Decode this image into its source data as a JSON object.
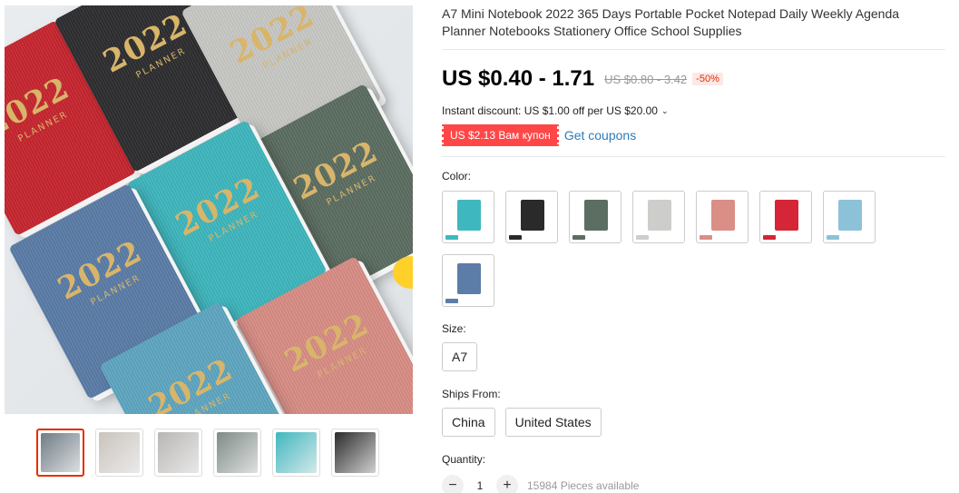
{
  "product": {
    "title": "A7 Mini Notebook 2022 365 Days Portable Pocket Notepad Daily Weekly Agenda Planner Notebooks Stationery Office School Supplies",
    "main_image": {
      "books": [
        {
          "color": "#c8262f",
          "text": "2022",
          "sub": "PLANNER"
        },
        {
          "color": "#2e2e30",
          "text": "2022",
          "sub": "PLANNER"
        },
        {
          "color": "#c9c9c6",
          "text": "2022",
          "sub": "PLANNER"
        },
        {
          "color": "#5c6e62",
          "text": "2022",
          "sub": "PLANNER"
        },
        {
          "color": "#3fb7bf",
          "text": "2022",
          "sub": "PLANNER"
        },
        {
          "color": "#5b7da8",
          "text": "2022",
          "sub": "PLANNER"
        },
        {
          "color": "#d98e86",
          "text": "2022",
          "sub": "PLANNER"
        },
        {
          "color": "#5fa7c2",
          "text": "2022",
          "sub": "PLANNER"
        }
      ]
    },
    "thumbnails": [
      {
        "color": "#6f7c85",
        "active": true
      },
      {
        "color": "#c9c3bd",
        "active": false
      },
      {
        "color": "#b8b6b4",
        "active": false
      },
      {
        "color": "#7e8a86",
        "active": false
      },
      {
        "color": "#3fb7bf",
        "active": false
      },
      {
        "color": "#2a2a2a",
        "active": false
      }
    ]
  },
  "pricing": {
    "price": "US $0.40 - 1.71",
    "old_price": "US $0.80 - 3.42",
    "discount": "-50%",
    "instant_discount": "Instant discount: US $1.00 off per US $20.00",
    "coupon": "US $2.13 Вам купон",
    "get_coupons": "Get coupons"
  },
  "options": {
    "color_label": "Color:",
    "colors": [
      {
        "name": "teal",
        "color": "#3fb7bf"
      },
      {
        "name": "black",
        "color": "#2a2a2a"
      },
      {
        "name": "green",
        "color": "#5c6e62"
      },
      {
        "name": "grey",
        "color": "#cdcdcb"
      },
      {
        "name": "pink",
        "color": "#d98e86"
      },
      {
        "name": "red",
        "color": "#d42636"
      },
      {
        "name": "light-blue",
        "color": "#8cc2d8"
      },
      {
        "name": "blue",
        "color": "#5b7da8"
      }
    ],
    "size_label": "Size:",
    "size_value": "A7",
    "ships_label": "Ships From:",
    "ships_options": [
      "China",
      "United States"
    ],
    "quantity_label": "Quantity:",
    "quantity_value": "1",
    "minus": "−",
    "plus": "+",
    "available": "15984 Pieces available"
  }
}
